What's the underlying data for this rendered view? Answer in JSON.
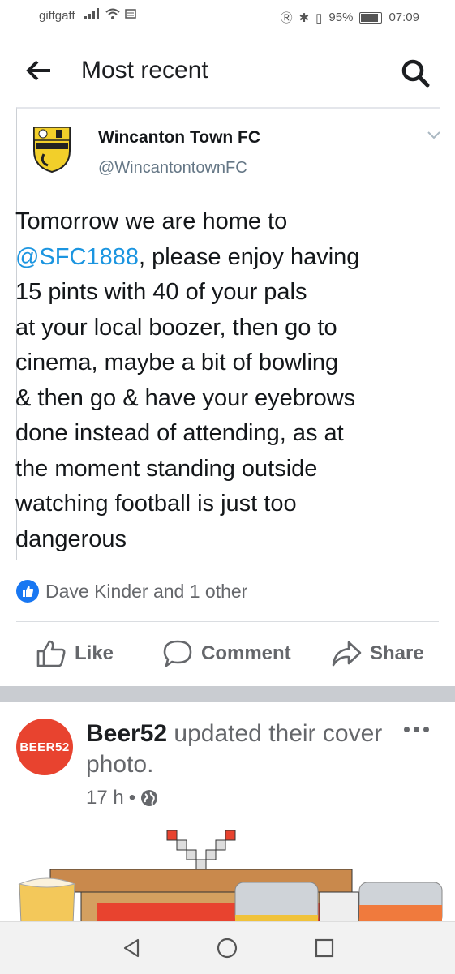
{
  "status_bar": {
    "carrier": "giffgaff",
    "battery": "95%",
    "time": "07:09"
  },
  "app_bar": {
    "title": "Most recent"
  },
  "tweet": {
    "name": "Wincanton Town FC",
    "handle": "@WincantontownFC",
    "text_before": "Tomorrow we are home to\n",
    "mention": "@SFC1888",
    "text_after": ", please enjoy having\n15 pints with 40 of your pals\nat your local boozer, then go to\ncinema, maybe a bit of bowling\n& then go & have your eyebrows\ndone instead of attending, as at\nthe moment standing outside\nwatching football is just too\ndangerous"
  },
  "reactions": {
    "text": "Dave Kinder and 1 other"
  },
  "actions": {
    "like": "Like",
    "comment": "Comment",
    "share": "Share"
  },
  "post": {
    "avatar_text": "BEER52",
    "author": "Beer52",
    "action_text": " updated their cover photo.",
    "time": "17 h",
    "dot": "•"
  },
  "colors": {
    "facebook_blue": "#1877f2",
    "twitter_link": "#1b95e0",
    "beer52_red": "#e8432f"
  }
}
